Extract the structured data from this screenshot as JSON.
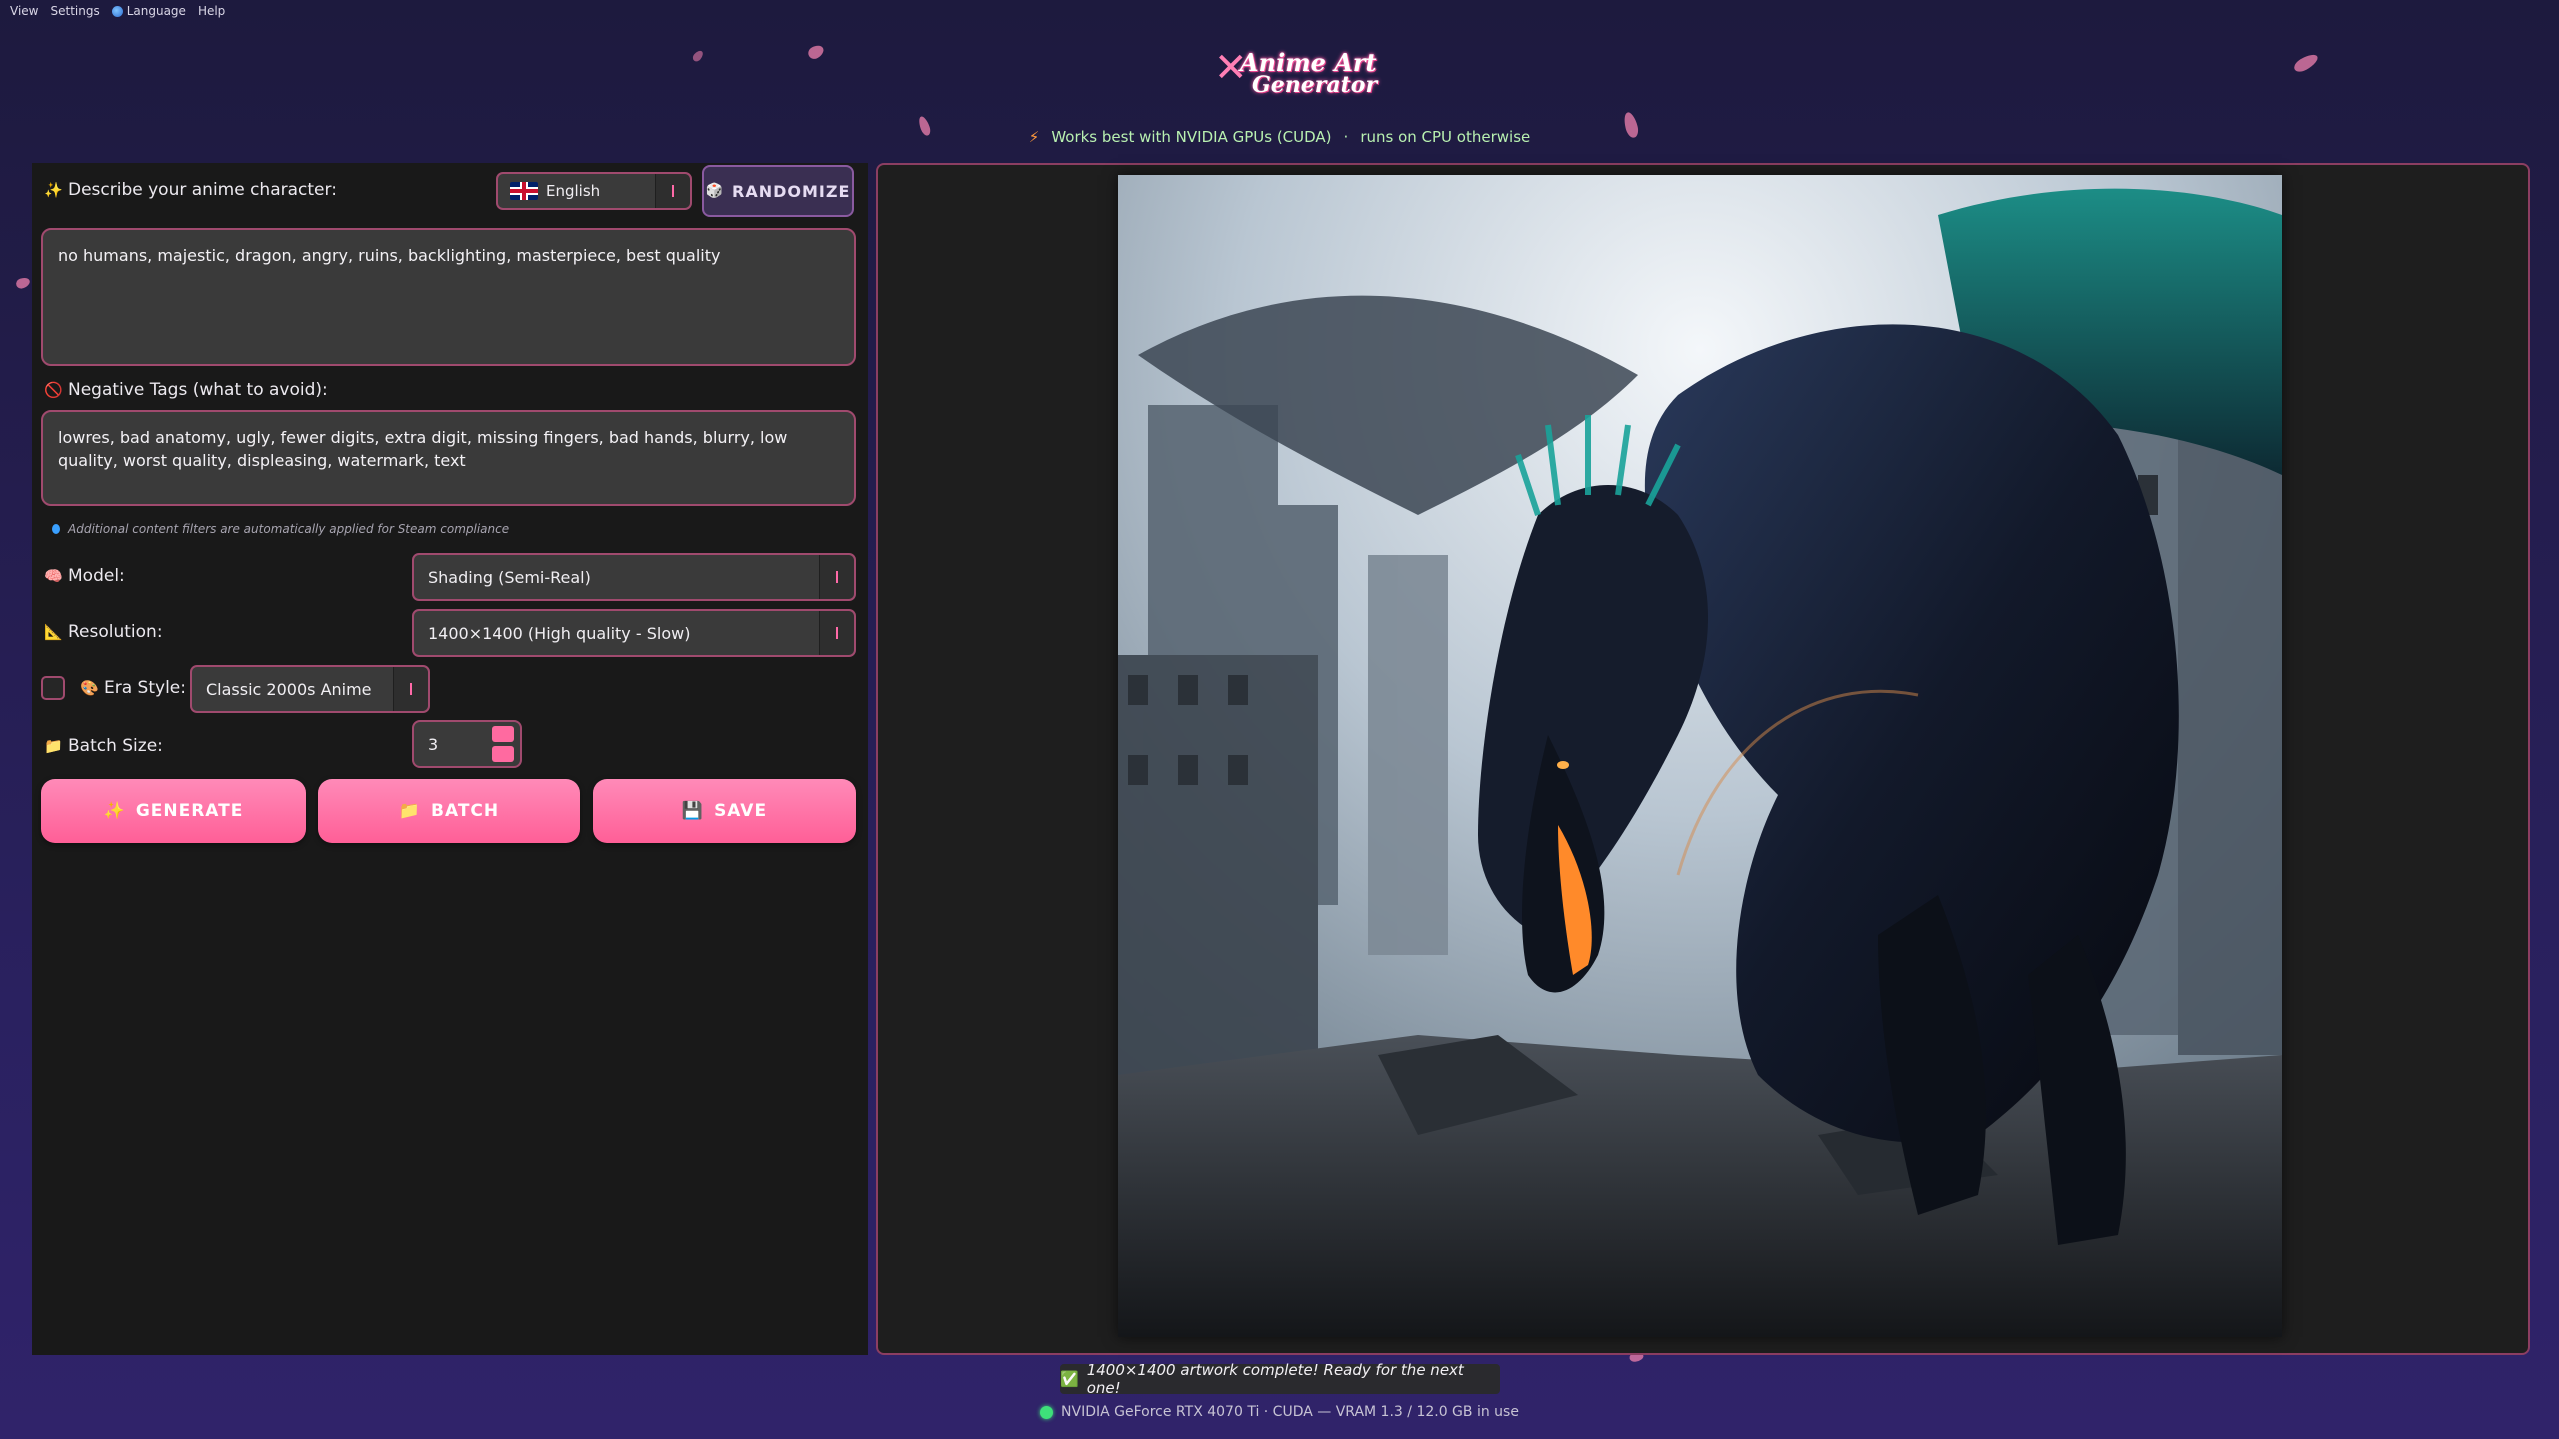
{
  "menu": [
    "View",
    "Settings",
    "Language",
    "Help"
  ],
  "logo": {
    "line1": "Anime Art",
    "line2": "Generator"
  },
  "gpu_note": {
    "part1": "Works best with NVIDIA GPUs (CUDA)",
    "part2": "runs on CPU otherwise"
  },
  "prompt": {
    "label": "Describe your anime character:",
    "language": "English",
    "randomize_label": "RANDOMIZE",
    "value": "no humans, majestic, dragon, angry, ruins, backlighting, masterpiece, best quality"
  },
  "negative": {
    "label": "Negative Tags (what to avoid):",
    "value": "lowres, bad anatomy, ugly, fewer digits, extra digit, missing fingers, bad hands, blurry, low quality, worst quality, displeasing, watermark, text"
  },
  "filter_note": "Additional content filters are automatically applied for Steam compliance",
  "model": {
    "label": "Model:",
    "value": "Shading (Semi-Real)"
  },
  "resolution": {
    "label": "Resolution:",
    "value": "1400×1400 (High quality - Slow)"
  },
  "era": {
    "label": "Era Style:",
    "value": "Classic 2000s Anime",
    "enabled": false
  },
  "batch": {
    "label": "Batch Size:",
    "value": "3"
  },
  "buttons": {
    "generate": "GENERATE",
    "batch": "BATCH",
    "save": "SAVE"
  },
  "status": "1400×1400 artwork complete! Ready for the next one!",
  "gpu_status": "NVIDIA GeForce RTX 4070 Ti · CUDA — VRAM 1.3 / 12.0 GB in use",
  "colors": {
    "accent": "#ff6aa0",
    "border": "#a04a6e",
    "panel": "#191919"
  }
}
